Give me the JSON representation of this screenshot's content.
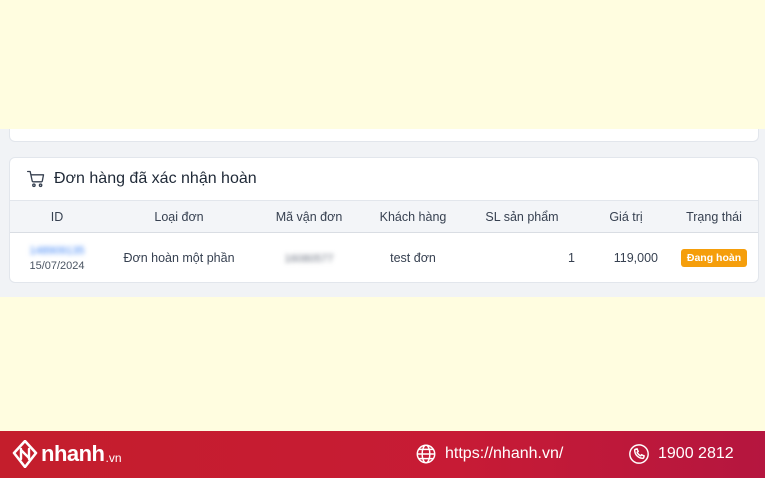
{
  "card": {
    "title": "Đơn hàng đã xác nhận hoàn",
    "icon": "cart-icon"
  },
  "table": {
    "headers": [
      "ID",
      "Loại đơn",
      "Mã vận đơn",
      "Khách hàng",
      "SL sản phẩm",
      "Giá trị",
      "Trạng thái"
    ],
    "rows": [
      {
        "id": "148909135",
        "date": "15/07/2024",
        "type": "Đơn hoàn một phần",
        "shipping_code": "16080577",
        "customer": "test đơn",
        "quantity": "1",
        "value": "119,000",
        "status": "Đang hoàn"
      }
    ]
  },
  "footer": {
    "brand": "nhanh",
    "brand_suffix": ".vn",
    "website": "https://nhanh.vn/",
    "phone": "1900 2812",
    "accent_color": "#c41e2c"
  },
  "colors": {
    "status_badge": "#f59e0b",
    "link": "#3b82f6"
  }
}
